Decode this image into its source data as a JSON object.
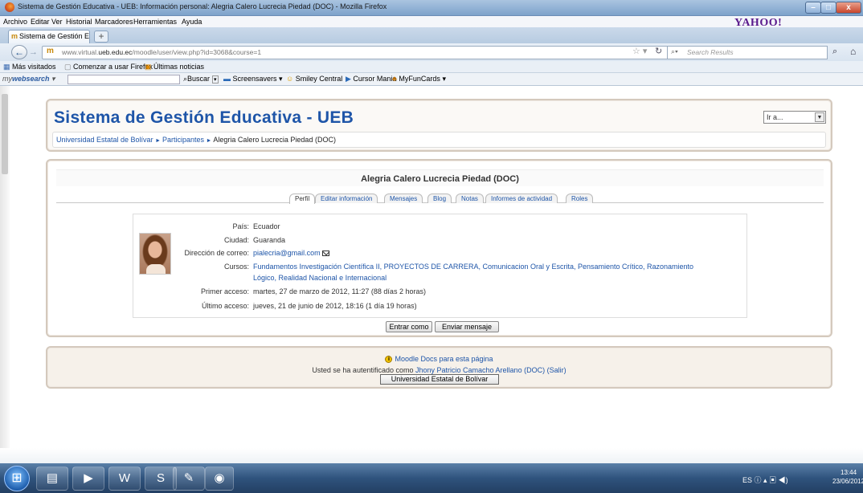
{
  "window": {
    "title": "Sistema de Gestión Educativa - UEB: Información personal: Alegria Calero Lucrecia Piedad (DOC) - Mozilla Firefox",
    "min": "–",
    "max": "□",
    "close": "x"
  },
  "menu": [
    "Archivo",
    "Editar",
    "Ver",
    "Historial",
    "Marcadores",
    "Herramientas",
    "Ayuda"
  ],
  "yahoo": "YAHOO!",
  "tab": {
    "label": "Sistema de Gestión Educativa - UEB: Info...",
    "new": "+"
  },
  "nav": {
    "url_prefix": "www.virtual.",
    "url_domain": "ueb.edu.ec",
    "url_suffix": "/moodle/user/view.php?id=3068&course=1",
    "search_placeholder": "Search Results"
  },
  "bookmarks": [
    "Más visitados",
    "Comenzar a usar Firefox",
    "Últimas noticias"
  ],
  "mywebsearch": {
    "logo_pre": "my",
    "logo_bold": "websearch",
    "items": [
      "Buscar",
      "Screensavers",
      "Smiley Central",
      "Cursor Mania",
      "MyFunCards"
    ]
  },
  "site": {
    "title": "Sistema de Gestión Educativa - UEB",
    "jump_label": "Ir a...",
    "breadcrumb": [
      "Universidad Estatal de Bolívar",
      "Participantes",
      "Alegria Calero Lucrecia Piedad (DOC)"
    ]
  },
  "user": {
    "name": "Alegria Calero Lucrecia Piedad (DOC)",
    "tabs": [
      "Perfil",
      "Editar información",
      "Mensajes",
      "Blog",
      "Notas",
      "Informes de actividad",
      "Roles"
    ],
    "fields": {
      "pais_label": "País:",
      "pais": "Ecuador",
      "ciudad_label": "Ciudad:",
      "ciudad": "Guaranda",
      "email_label": "Dirección de correo:",
      "email": "pialecria@gmail.com",
      "cursos_label": "Cursos:",
      "cursos_line1": "Fundamentos Investigación Científica II, PROYECTOS DE CARRERA, Comunicacion Oral y Escrita, Pensamiento Crítico, Razonamiento",
      "cursos_line2": "Lógico, Realidad Nacional e Internacional",
      "primer_label": "Primer acceso:",
      "primer": "martes, 27 de marzo de 2012, 11:27  (88 días 2 horas)",
      "ultimo_label": "Último acceso:",
      "ultimo": "jueves, 21 de junio de 2012, 18:16  (1 día 19 horas)"
    },
    "buttons": {
      "login_as": "Entrar como",
      "send_message": "Enviar mensaje"
    }
  },
  "footer": {
    "docs_link": "Moodle Docs para esta página",
    "login_prefix": "Usted se ha autentificado como",
    "login_user": "Jhony Patricio Camacho Arellano (DOC)",
    "logout": "(Salir)",
    "home_button": "Universidad Estatal de Bolívar"
  },
  "taskbar": {
    "lang": "ES",
    "time": "13:44",
    "date": "23/06/2012"
  }
}
